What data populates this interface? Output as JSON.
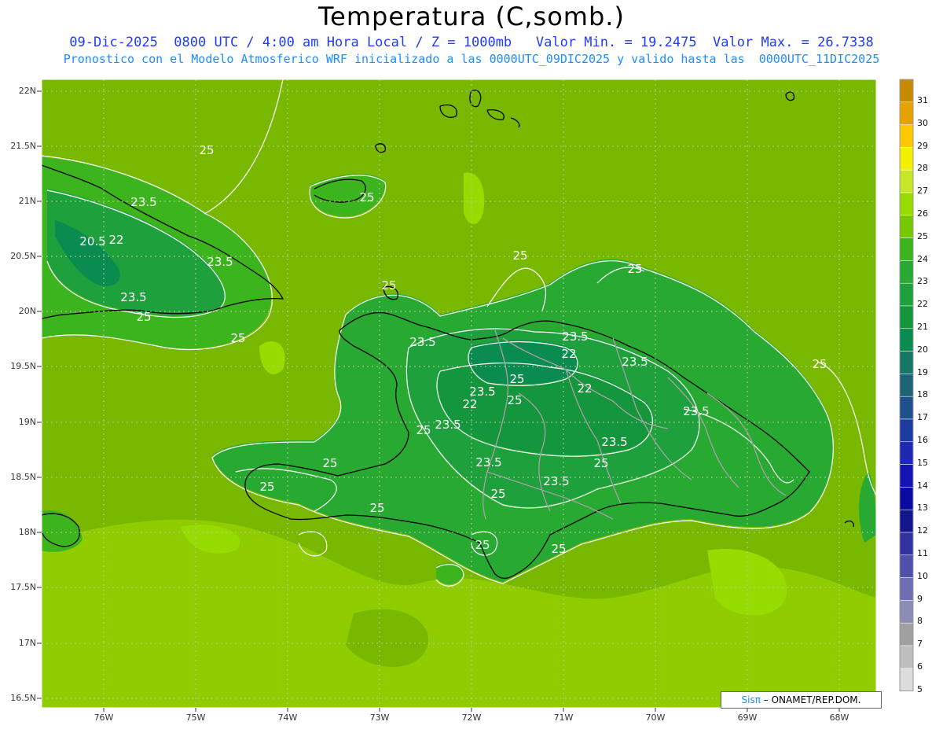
{
  "header": {
    "title": "Temperatura (C,somb.)",
    "line1": "09-Dic-2025  0800 UTC / 4:00 am Hora Local / Z = 1000mb   Valor Min. = 19.2475  Valor Max. = 26.7338",
    "line2": "Pronostico con el Modelo Atmosferico WRF inicializado a las 0000UTC_09DIC2025 y valido hasta las  0000UTC_11DIC2025"
  },
  "axes": {
    "lat_labels": [
      "22N",
      "21.5N",
      "21N",
      "20.5N",
      "20N",
      "19.5N",
      "19N",
      "18.5N",
      "18N",
      "17.5N",
      "17N",
      "16.5N"
    ],
    "lon_labels": [
      "76W",
      "75W",
      "74W",
      "73W",
      "72W",
      "71W",
      "70W",
      "69W",
      "68W"
    ]
  },
  "colorbar": {
    "levels": [
      "31",
      "30",
      "29",
      "28",
      "27",
      "26",
      "25",
      "24",
      "23",
      "22",
      "21",
      "20",
      "19",
      "18",
      "17",
      "16",
      "15",
      "14",
      "13",
      "12",
      "11",
      "10",
      "9",
      "8",
      "7",
      "6",
      "5"
    ],
    "colors": [
      "#c88a00",
      "#e6a200",
      "#ffc800",
      "#f5f000",
      "#c8e628",
      "#96dc00",
      "#78c800",
      "#3cb41e",
      "#28aa32",
      "#1ea03c",
      "#14963c",
      "#0a8c50",
      "#147864",
      "#1e6478",
      "#1e508c",
      "#1e3ca0",
      "#1e28b4",
      "#1414b4",
      "#0a0aa0",
      "#14148c",
      "#3232a0",
      "#5050aa",
      "#6e6eb4",
      "#8c8cb4",
      "#a0a0a0",
      "#bebebe",
      "#dcdcdc"
    ]
  },
  "contour_labels": [
    {
      "text": "25"
    },
    {
      "text": "23.5"
    },
    {
      "text": "20.5"
    },
    {
      "text": "22"
    },
    {
      "text": "23.5"
    },
    {
      "text": "23.5"
    },
    {
      "text": "25"
    },
    {
      "text": "25"
    },
    {
      "text": "25"
    },
    {
      "text": "25"
    },
    {
      "text": "25"
    },
    {
      "text": "25"
    },
    {
      "text": "23.5"
    },
    {
      "text": "23.5"
    },
    {
      "text": "22"
    },
    {
      "text": "23.5"
    },
    {
      "text": "23.5"
    },
    {
      "text": "25"
    },
    {
      "text": "22"
    },
    {
      "text": "25"
    },
    {
      "text": "22"
    },
    {
      "text": "23.5"
    },
    {
      "text": "23.5"
    },
    {
      "text": "25"
    },
    {
      "text": "23.5"
    },
    {
      "text": "25"
    },
    {
      "text": "25"
    },
    {
      "text": "25"
    },
    {
      "text": "25"
    },
    {
      "text": "23.5"
    },
    {
      "text": "25"
    },
    {
      "text": "25"
    },
    {
      "text": "25"
    },
    {
      "text": "23.5"
    },
    {
      "text": "25"
    }
  ],
  "credit": {
    "sis": "Sisπ",
    "rest": " – ONAMET/REP.DOM."
  }
}
